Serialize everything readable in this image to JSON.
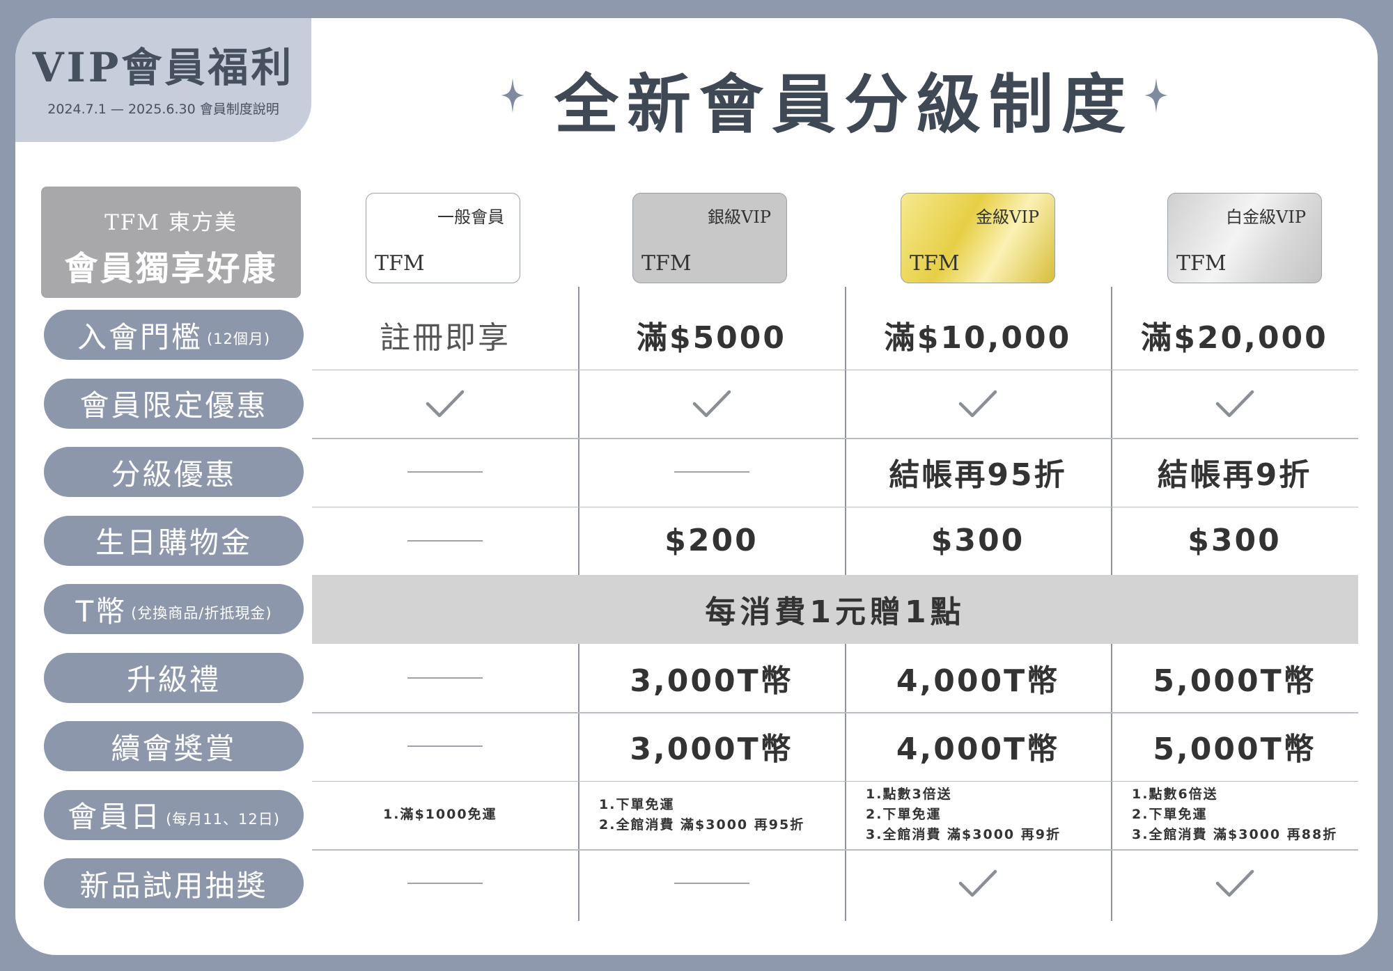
{
  "tag": {
    "title": "VIP會員福利",
    "subtitle": "2024.7.1 — 2025.6.30 會員制度說明"
  },
  "title": "全新會員分級制度",
  "brand": {
    "line1": "TFM 東方美",
    "line2": "會員獨享好康"
  },
  "tiers": [
    {
      "name": "一般會員",
      "brand": "TFM",
      "style": "white"
    },
    {
      "name": "銀級VIP",
      "brand": "TFM",
      "style": "silver"
    },
    {
      "name": "金級VIP",
      "brand": "TFM",
      "style": "gold"
    },
    {
      "name": "白金級VIP",
      "brand": "TFM",
      "style": "platinum"
    }
  ],
  "rows": [
    {
      "label": "入會門檻",
      "note": "(12個月)",
      "values": [
        "註冊即享",
        "滿$5000",
        "滿$10,000",
        "滿$20,000"
      ]
    },
    {
      "label": "會員限定優惠",
      "note": "",
      "values": [
        "check",
        "check",
        "check",
        "check"
      ]
    },
    {
      "label": "分級優惠",
      "note": "",
      "values": [
        "dash",
        "dash",
        "結帳再95折",
        "結帳再9折"
      ]
    },
    {
      "label": "生日購物金",
      "note": "",
      "values": [
        "dash",
        "$200",
        "$300",
        "$300"
      ]
    },
    {
      "label": "T幣",
      "note": "(兌換商品/折抵現金)",
      "merged": "每消費1元贈1點"
    },
    {
      "label": "升級禮",
      "note": "",
      "values": [
        "dash",
        "3,000T幣",
        "4,000T幣",
        "5,000T幣"
      ]
    },
    {
      "label": "續會獎賞",
      "note": "",
      "values": [
        "dash",
        "3,000T幣",
        "4,000T幣",
        "5,000T幣"
      ]
    },
    {
      "label": "會員日",
      "note": "(每月11、12日)",
      "values": [
        [
          "1.滿$1000免運"
        ],
        [
          "1.下單免運",
          "2.全館消費 滿$3000 再95折"
        ],
        [
          "1.點數3倍送",
          "2.下單免運",
          "3.全館消費 滿$3000 再9折"
        ],
        [
          "1.點數6倍送",
          "2.下單免運",
          "3.全館消費 滿$3000 再88折"
        ]
      ]
    },
    {
      "label": "新品試用抽獎",
      "note": "",
      "values": [
        "dash",
        "dash",
        "check",
        "check"
      ]
    }
  ],
  "colors": {
    "frame": "#8e99ad",
    "pill": "#8c97ac",
    "tag": "#c7cddb",
    "band": "#d3d3d3",
    "title": "#3f4956"
  }
}
